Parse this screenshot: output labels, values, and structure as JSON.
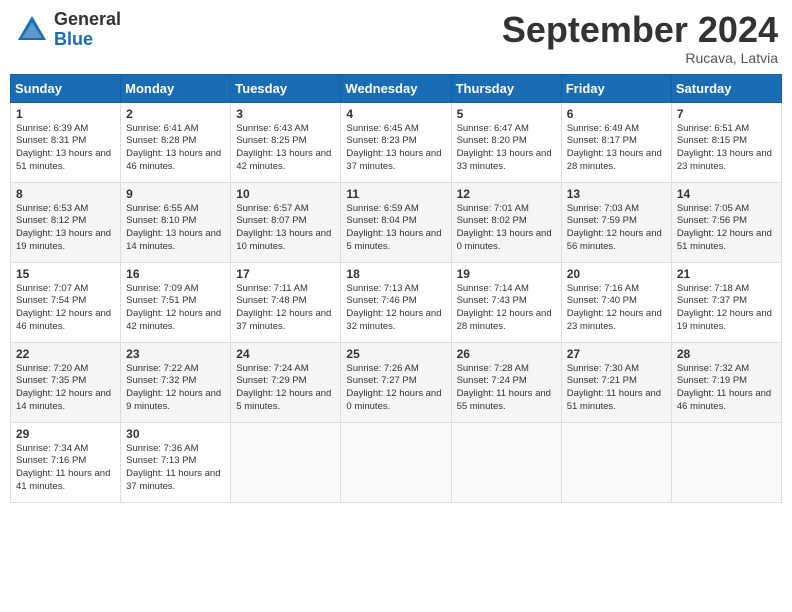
{
  "header": {
    "logo_general": "General",
    "logo_blue": "Blue",
    "month_title": "September 2024",
    "location": "Rucava, Latvia"
  },
  "weekdays": [
    "Sunday",
    "Monday",
    "Tuesday",
    "Wednesday",
    "Thursday",
    "Friday",
    "Saturday"
  ],
  "weeks": [
    [
      {
        "day": 1,
        "sunrise": "Sunrise: 6:39 AM",
        "sunset": "Sunset: 8:31 PM",
        "daylight": "Daylight: 13 hours and 51 minutes."
      },
      {
        "day": 2,
        "sunrise": "Sunrise: 6:41 AM",
        "sunset": "Sunset: 8:28 PM",
        "daylight": "Daylight: 13 hours and 46 minutes."
      },
      {
        "day": 3,
        "sunrise": "Sunrise: 6:43 AM",
        "sunset": "Sunset: 8:25 PM",
        "daylight": "Daylight: 13 hours and 42 minutes."
      },
      {
        "day": 4,
        "sunrise": "Sunrise: 6:45 AM",
        "sunset": "Sunset: 8:23 PM",
        "daylight": "Daylight: 13 hours and 37 minutes."
      },
      {
        "day": 5,
        "sunrise": "Sunrise: 6:47 AM",
        "sunset": "Sunset: 8:20 PM",
        "daylight": "Daylight: 13 hours and 33 minutes."
      },
      {
        "day": 6,
        "sunrise": "Sunrise: 6:49 AM",
        "sunset": "Sunset: 8:17 PM",
        "daylight": "Daylight: 13 hours and 28 minutes."
      },
      {
        "day": 7,
        "sunrise": "Sunrise: 6:51 AM",
        "sunset": "Sunset: 8:15 PM",
        "daylight": "Daylight: 13 hours and 23 minutes."
      }
    ],
    [
      {
        "day": 8,
        "sunrise": "Sunrise: 6:53 AM",
        "sunset": "Sunset: 8:12 PM",
        "daylight": "Daylight: 13 hours and 19 minutes."
      },
      {
        "day": 9,
        "sunrise": "Sunrise: 6:55 AM",
        "sunset": "Sunset: 8:10 PM",
        "daylight": "Daylight: 13 hours and 14 minutes."
      },
      {
        "day": 10,
        "sunrise": "Sunrise: 6:57 AM",
        "sunset": "Sunset: 8:07 PM",
        "daylight": "Daylight: 13 hours and 10 minutes."
      },
      {
        "day": 11,
        "sunrise": "Sunrise: 6:59 AM",
        "sunset": "Sunset: 8:04 PM",
        "daylight": "Daylight: 13 hours and 5 minutes."
      },
      {
        "day": 12,
        "sunrise": "Sunrise: 7:01 AM",
        "sunset": "Sunset: 8:02 PM",
        "daylight": "Daylight: 13 hours and 0 minutes."
      },
      {
        "day": 13,
        "sunrise": "Sunrise: 7:03 AM",
        "sunset": "Sunset: 7:59 PM",
        "daylight": "Daylight: 12 hours and 56 minutes."
      },
      {
        "day": 14,
        "sunrise": "Sunrise: 7:05 AM",
        "sunset": "Sunset: 7:56 PM",
        "daylight": "Daylight: 12 hours and 51 minutes."
      }
    ],
    [
      {
        "day": 15,
        "sunrise": "Sunrise: 7:07 AM",
        "sunset": "Sunset: 7:54 PM",
        "daylight": "Daylight: 12 hours and 46 minutes."
      },
      {
        "day": 16,
        "sunrise": "Sunrise: 7:09 AM",
        "sunset": "Sunset: 7:51 PM",
        "daylight": "Daylight: 12 hours and 42 minutes."
      },
      {
        "day": 17,
        "sunrise": "Sunrise: 7:11 AM",
        "sunset": "Sunset: 7:48 PM",
        "daylight": "Daylight: 12 hours and 37 minutes."
      },
      {
        "day": 18,
        "sunrise": "Sunrise: 7:13 AM",
        "sunset": "Sunset: 7:46 PM",
        "daylight": "Daylight: 12 hours and 32 minutes."
      },
      {
        "day": 19,
        "sunrise": "Sunrise: 7:14 AM",
        "sunset": "Sunset: 7:43 PM",
        "daylight": "Daylight: 12 hours and 28 minutes."
      },
      {
        "day": 20,
        "sunrise": "Sunrise: 7:16 AM",
        "sunset": "Sunset: 7:40 PM",
        "daylight": "Daylight: 12 hours and 23 minutes."
      },
      {
        "day": 21,
        "sunrise": "Sunrise: 7:18 AM",
        "sunset": "Sunset: 7:37 PM",
        "daylight": "Daylight: 12 hours and 19 minutes."
      }
    ],
    [
      {
        "day": 22,
        "sunrise": "Sunrise: 7:20 AM",
        "sunset": "Sunset: 7:35 PM",
        "daylight": "Daylight: 12 hours and 14 minutes."
      },
      {
        "day": 23,
        "sunrise": "Sunrise: 7:22 AM",
        "sunset": "Sunset: 7:32 PM",
        "daylight": "Daylight: 12 hours and 9 minutes."
      },
      {
        "day": 24,
        "sunrise": "Sunrise: 7:24 AM",
        "sunset": "Sunset: 7:29 PM",
        "daylight": "Daylight: 12 hours and 5 minutes."
      },
      {
        "day": 25,
        "sunrise": "Sunrise: 7:26 AM",
        "sunset": "Sunset: 7:27 PM",
        "daylight": "Daylight: 12 hours and 0 minutes."
      },
      {
        "day": 26,
        "sunrise": "Sunrise: 7:28 AM",
        "sunset": "Sunset: 7:24 PM",
        "daylight": "Daylight: 11 hours and 55 minutes."
      },
      {
        "day": 27,
        "sunrise": "Sunrise: 7:30 AM",
        "sunset": "Sunset: 7:21 PM",
        "daylight": "Daylight: 11 hours and 51 minutes."
      },
      {
        "day": 28,
        "sunrise": "Sunrise: 7:32 AM",
        "sunset": "Sunset: 7:19 PM",
        "daylight": "Daylight: 11 hours and 46 minutes."
      }
    ],
    [
      {
        "day": 29,
        "sunrise": "Sunrise: 7:34 AM",
        "sunset": "Sunset: 7:16 PM",
        "daylight": "Daylight: 11 hours and 41 minutes."
      },
      {
        "day": 30,
        "sunrise": "Sunrise: 7:36 AM",
        "sunset": "Sunset: 7:13 PM",
        "daylight": "Daylight: 11 hours and 37 minutes."
      },
      null,
      null,
      null,
      null,
      null
    ]
  ]
}
